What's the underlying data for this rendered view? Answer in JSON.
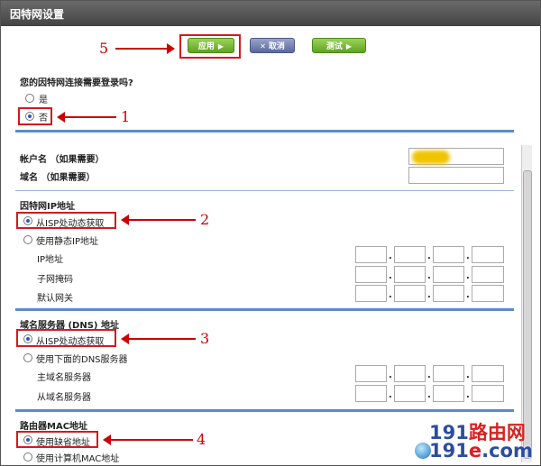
{
  "title": "因特网设置",
  "toolbar": {
    "apply_label": "应用",
    "cancel_label": "取消",
    "test_label": "测试"
  },
  "login_question": {
    "label": "您的因特网连接需要登录吗?",
    "yes": "是",
    "no": "否"
  },
  "account": {
    "username_label": "帐户名 （如果需要）",
    "domain_label": "域名 （如果需要）"
  },
  "ip_section": {
    "title": "因特网IP地址",
    "auto_label": "从ISP处动态获取",
    "static_label": "使用静态IP地址",
    "ip_label": "IP地址",
    "subnet_label": "子网掩码",
    "gateway_label": "默认网关"
  },
  "dns_section": {
    "title": "域名服务器 (DNS) 地址",
    "auto_label": "从ISP处动态获取",
    "manual_label": "使用下面的DNS服务器",
    "primary_label": "主域名服务器",
    "secondary_label": "从域名服务器"
  },
  "mac_section": {
    "title": "路由器MAC地址",
    "default_label": "使用缺省地址",
    "computer_label": "使用计算机MAC地址"
  },
  "annotations": [
    "5",
    "1",
    "2",
    "3",
    "4"
  ],
  "watermark": {
    "line1_a": "191",
    "line1_b": "路由网",
    "line2_a": "191",
    "line2_b": "e",
    "line2_c": ".com"
  }
}
